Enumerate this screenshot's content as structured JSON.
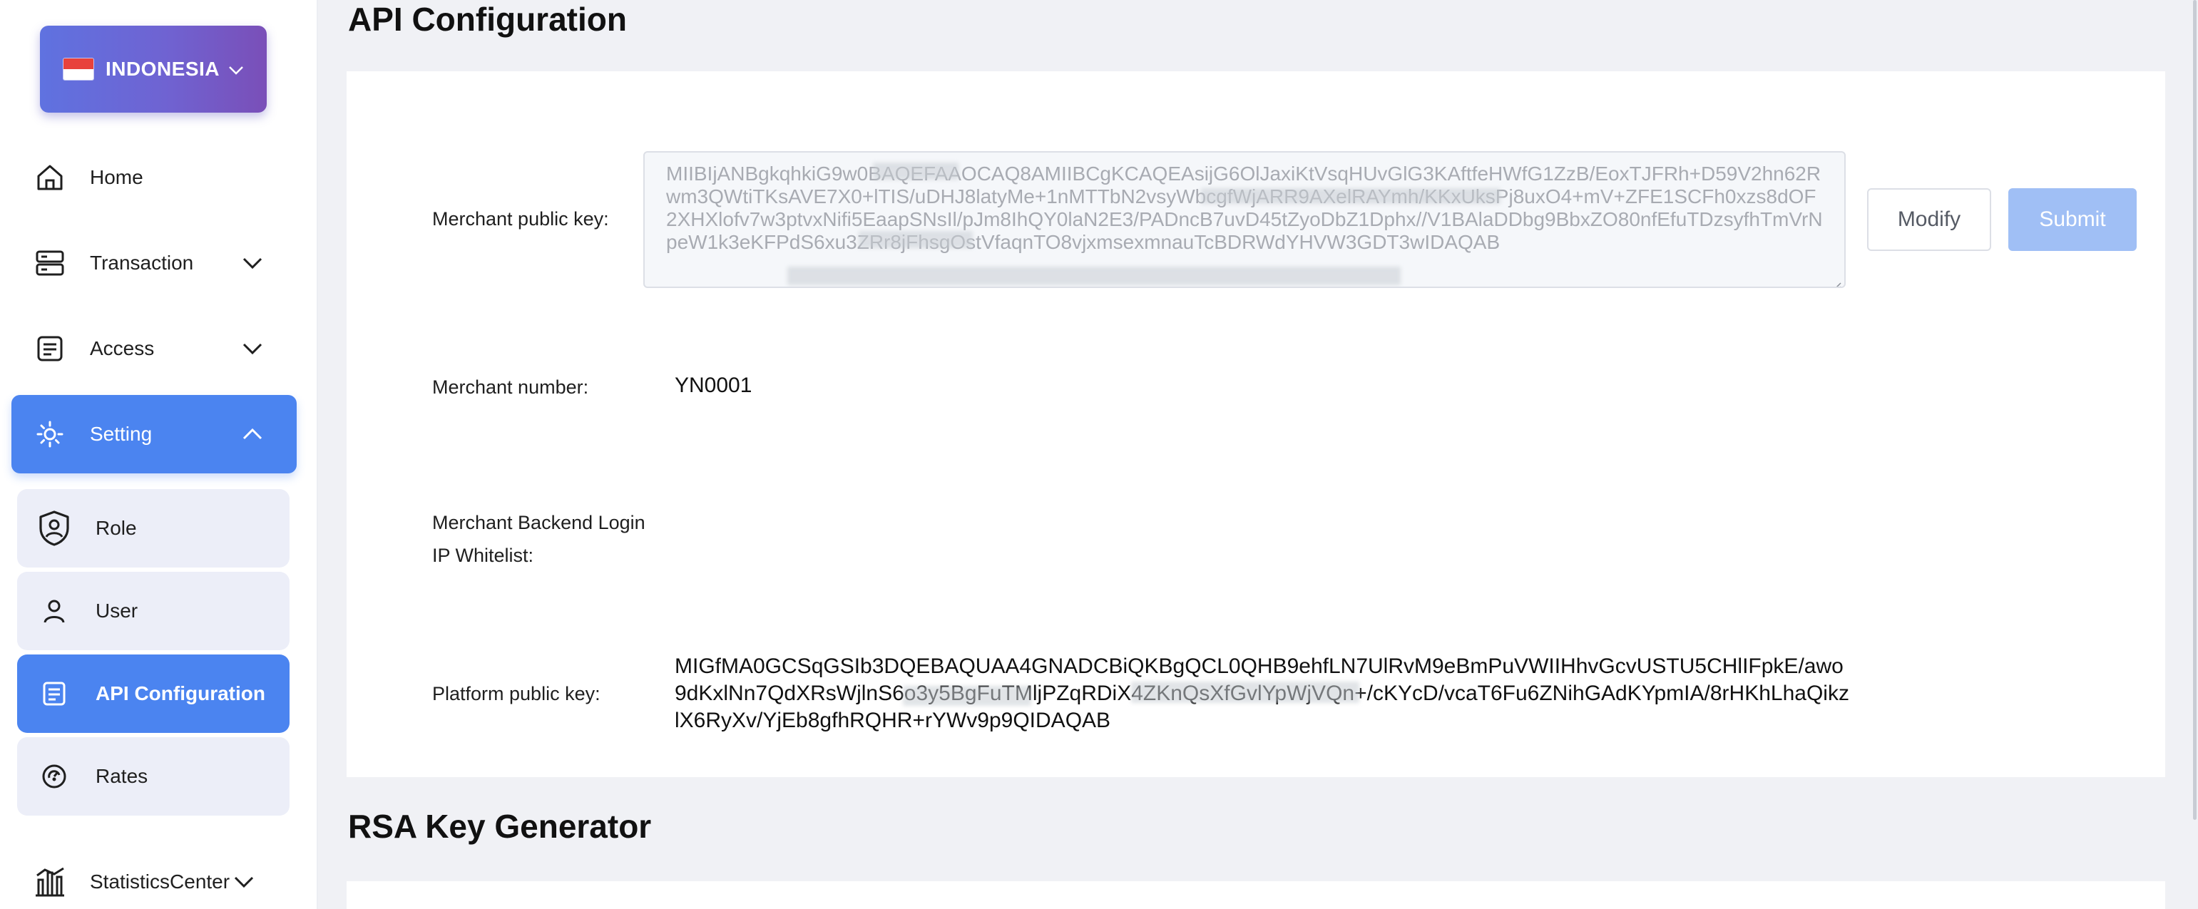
{
  "sidebar": {
    "country": {
      "label": "INDONESIA"
    },
    "items": [
      {
        "label": "Home",
        "icon": "home-icon"
      },
      {
        "label": "Transaction",
        "icon": "transaction-icon"
      },
      {
        "label": "Access",
        "icon": "access-icon"
      },
      {
        "label": "Setting",
        "icon": "setting-icon"
      }
    ],
    "setting_children": [
      {
        "label": "Role",
        "icon": "role-shield-icon"
      },
      {
        "label": "User",
        "icon": "user-icon"
      },
      {
        "label": "API Configuration",
        "icon": "api-document-icon"
      },
      {
        "label": "Rates",
        "icon": "rates-icon"
      }
    ],
    "statistics": {
      "label": "StatisticsCenter",
      "icon": "statistics-icon"
    }
  },
  "main": {
    "api_section_title": "API Configuration",
    "merchant_public_key": {
      "label": "Merchant public key:",
      "value": "MIIBIjANBgkqhkiG9w0BAQEFAAOCAQ8AMIIBCgKCAQEAsijG6OlJaxiKtVsqHUvGlG3KAftfeHWfG1ZzB/EoxTJFRh+D59V2hn62Rwm3QWtiTKsAVE7X0+lTIS/uDHJ8latyMe+1nMTTbN2vsyWbcgfWjARR9AXelRAYmh/KKxUksPj8uxO4+mV+ZFE1SCFh0xzs8dOF2XHXlofv7w3ptvxNifi5EaapSNsIl/pJm8IhQY0laN2E3/PADncB7uvD45tZyoDbZ1Dphx//V1BAlaDDbg9BbxZO80nfEfuTDzsyfhTmVrNpeW1k3eKFPdS6xu3ZRr8jFhsgOstVfaqnTO8vjxmsexmnauTcBDRWdYHVW3GDT3wIDAQAB"
    },
    "buttons": {
      "modify": "Modify",
      "submit": "Submit"
    },
    "merchant_number": {
      "label": "Merchant number:",
      "value": "YN0001"
    },
    "ip_whitelist": {
      "label_line1": "Merchant Backend Login",
      "label_line2": "IP Whitelist:"
    },
    "platform_public_key": {
      "label": "Platform public key:",
      "value": "MIGfMA0GCSqGSIb3DQEBAQUAA4GNADCBiQKBgQCL0QHB9ehfLN7UlRvM9eBmPuVWIIHhvGcvUSTU5CHlIFpkE/awo9dKxlNn7QdXRsWjlnS6o3y5BgFuTMljPZqRDiX4ZKnQsXfGvlYpWjVQn+/cKYcD/vcaT6Fu6ZNihGAdKYpmIA/8rHKhLhaQikzlX6RyXv/YjEb8gfhRQHR+rYWv9p9QIDAQAB"
    },
    "rsa_section_title": "RSA Key Generator"
  }
}
